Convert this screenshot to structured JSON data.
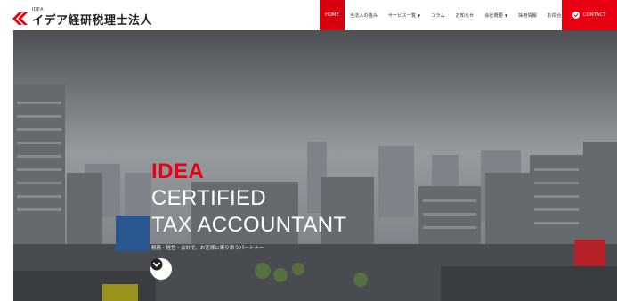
{
  "header": {
    "logo_small": "IDEA",
    "logo_name": "イデア経研税理士法人",
    "nav": [
      {
        "label": "HOME",
        "active": true
      },
      {
        "label": "当法人の強み",
        "dropdown": false
      },
      {
        "label": "サービス一覧",
        "dropdown": true
      },
      {
        "label": "コラム",
        "dropdown": false
      },
      {
        "label": "お知らせ",
        "dropdown": false
      },
      {
        "label": "会社概要",
        "dropdown": true
      },
      {
        "label": "採用情報",
        "dropdown": false
      },
      {
        "label": "お問合せ",
        "dropdown": false
      }
    ],
    "contact_label": "CONTACT"
  },
  "hero": {
    "title_line1": "IDEA",
    "title_line2": "CERTIFIED",
    "title_line3": "TAX ACCOUNTANT",
    "subtitle": "税務・経営・会計で、お客様に寄り添うパートナー"
  },
  "colors": {
    "accent": "#e60012",
    "active_nav": "#d7000f"
  }
}
